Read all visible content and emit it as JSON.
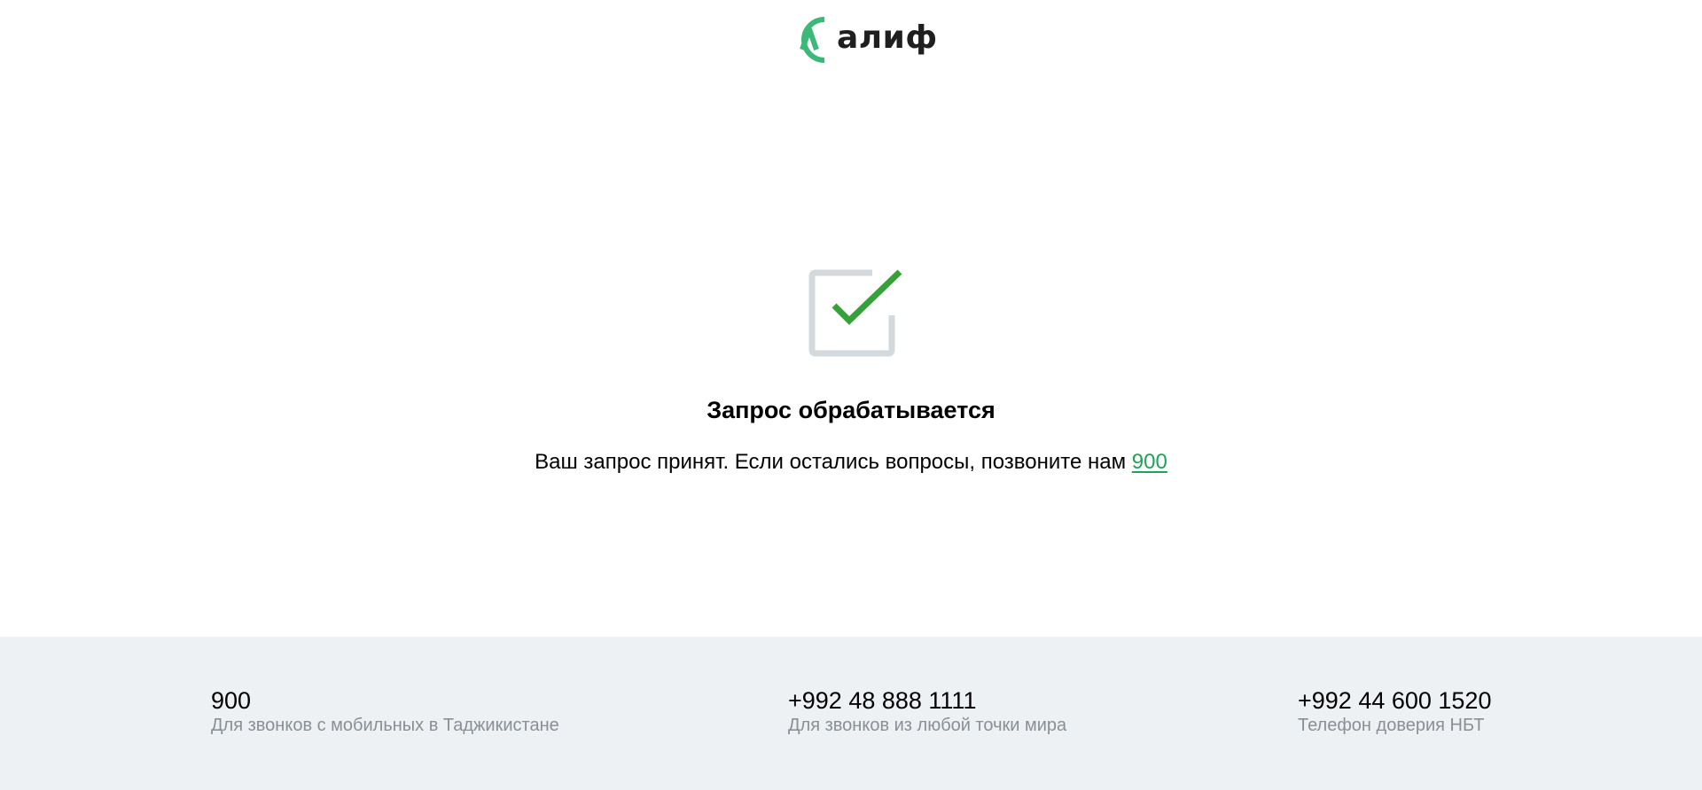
{
  "header": {
    "logo_text": "алиф",
    "brand_color": "#3cb878"
  },
  "main": {
    "icon": "checkbox-check-icon",
    "title": "Запрос обрабатывается",
    "message": "Ваш запрос принят. Если остались вопросы, позвоните нам ",
    "phone_link": "900",
    "link_color": "#1fa35a"
  },
  "footer": {
    "contacts": [
      {
        "number": "900",
        "description": "Для звонков с мобильных в Таджикистане"
      },
      {
        "number": "+992 48 888 1111",
        "description": "Для звонков из любой точки мира"
      },
      {
        "number": "+992 44 600 1520",
        "description": "Телефон доверия НБТ"
      }
    ],
    "background": "#edf1f4"
  }
}
